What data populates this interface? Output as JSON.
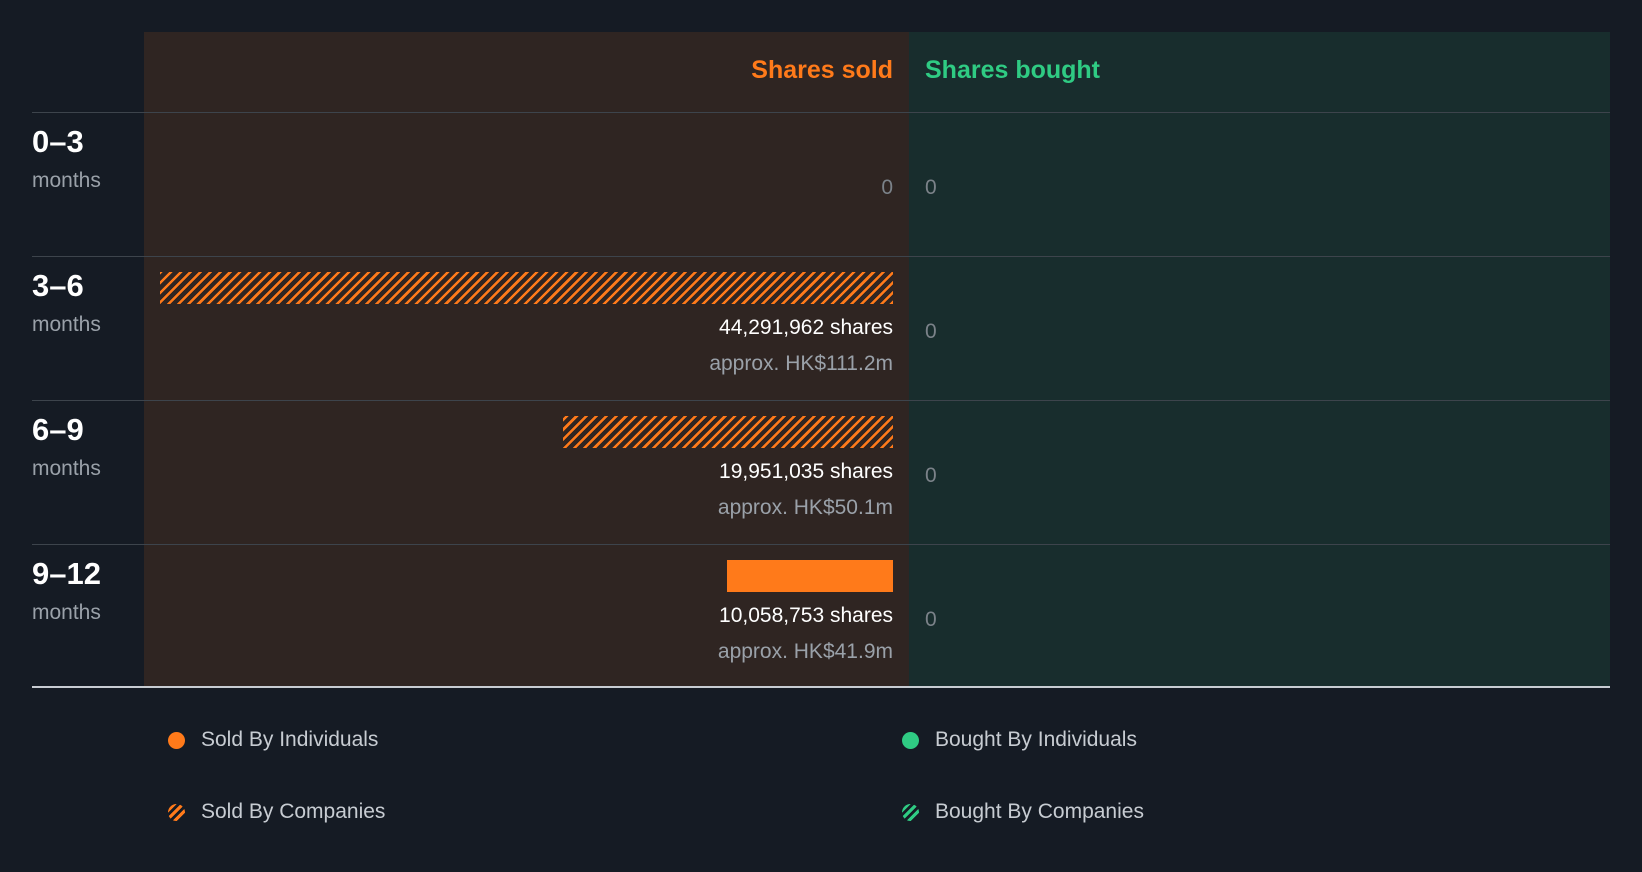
{
  "chart_data": {
    "type": "bar",
    "headers": {
      "sold": "Shares sold",
      "bought": "Shares bought"
    },
    "periods": [
      {
        "range": "0–3",
        "unit": "months",
        "sold_shares": 0,
        "sold_type": "none",
        "sold_shares_label": "",
        "sold_value_label": "",
        "sold_zero_label": "0",
        "bought_shares": 0,
        "bought_label": "0"
      },
      {
        "range": "3–6",
        "unit": "months",
        "sold_shares": 44291962,
        "sold_type": "companies",
        "sold_shares_label": "44,291,962 shares",
        "sold_value_label": "approx. HK$111.2m",
        "sold_zero_label": "",
        "bought_shares": 0,
        "bought_label": "0"
      },
      {
        "range": "6–9",
        "unit": "months",
        "sold_shares": 19951035,
        "sold_type": "companies",
        "sold_shares_label": "19,951,035 shares",
        "sold_value_label": "approx. HK$50.1m",
        "sold_zero_label": "",
        "bought_shares": 0,
        "bought_label": "0"
      },
      {
        "range": "9–12",
        "unit": "months",
        "sold_shares": 10058753,
        "sold_type": "individuals",
        "sold_shares_label": "10,058,753 shares",
        "sold_value_label": "approx. HK$41.9m",
        "sold_zero_label": "",
        "bought_shares": 0,
        "bought_label": "0"
      }
    ],
    "legend": [
      {
        "label": "Sold By Individuals",
        "marker": "solid",
        "color": "#ff7a1a"
      },
      {
        "label": "Bought By Individuals",
        "marker": "solid",
        "color": "#2fcb83"
      },
      {
        "label": "Sold By Companies",
        "marker": "hatched",
        "color": "#ff7a1a"
      },
      {
        "label": "Bought By Companies",
        "marker": "hatched",
        "color": "#2fcb83"
      }
    ],
    "colors": {
      "sold": "#ff7a1a",
      "bought": "#2fcb83",
      "background": "#151b24",
      "sold_panel": "#2f2522",
      "bought_panel": "#182d2d"
    }
  }
}
